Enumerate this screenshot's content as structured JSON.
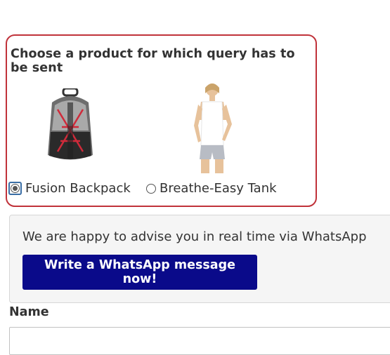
{
  "product_selector": {
    "title": "Choose a product for which query has to be sent",
    "options": [
      {
        "label": "Fusion Backpack",
        "selected": true
      },
      {
        "label": "Breathe-Easy Tank",
        "selected": false
      }
    ]
  },
  "whatsapp": {
    "text": "We are happy to advise you in real time via WhatsApp",
    "button_label": "Write a WhatsApp message now!",
    "button_color": "#0a0a8a"
  },
  "form": {
    "name_label": "Name",
    "name_value": ""
  },
  "colors": {
    "highlight_border": "#c0323a"
  }
}
